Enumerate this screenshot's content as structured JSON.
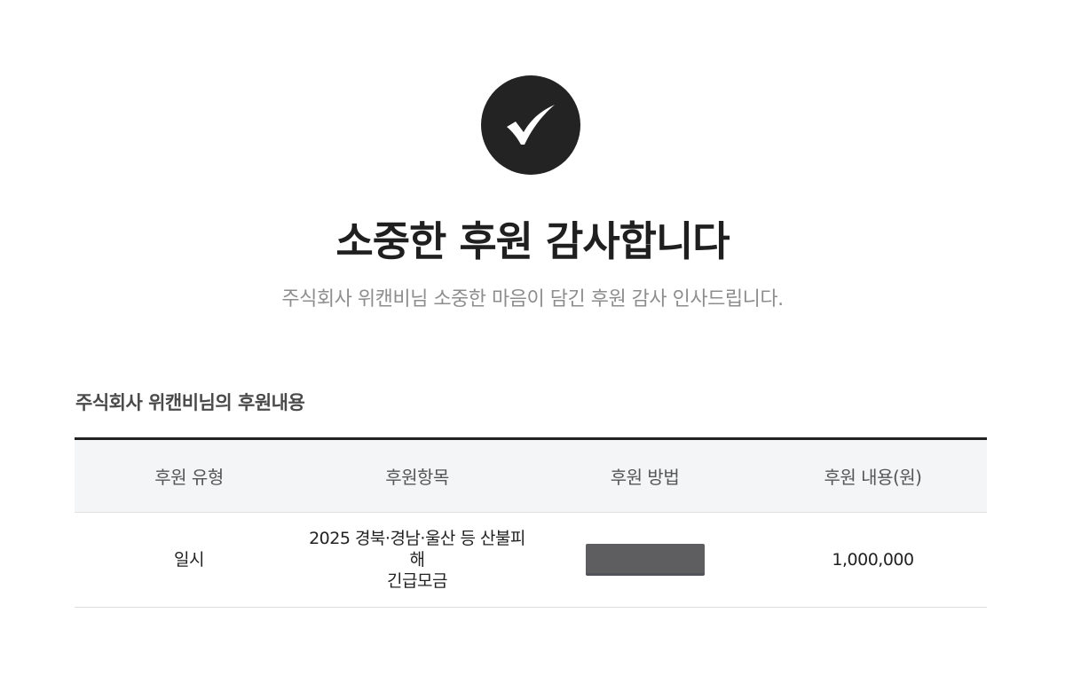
{
  "header": {
    "icon": "check-icon",
    "title": "소중한 후원 감사합니다",
    "subtitle": "주식회사 위캔비님 소중한 마음이 담긴 후원 감사 인사드립니다."
  },
  "section": {
    "title": "주식회사 위캔비님의 후원내용"
  },
  "table": {
    "headers": [
      "후원 유형",
      "후원항목",
      "후원 방법",
      "후원 내용(원)"
    ],
    "rows": [
      {
        "type": "일시",
        "item_line1": "2025 경북·경남·울산 등 산불피해",
        "item_line2": "긴급모금",
        "method": "",
        "amount": "1,000,000"
      }
    ]
  },
  "colors": {
    "icon_circle": "#232323",
    "header_bg": "#f4f5f6",
    "table_top_border": "#222222",
    "subtitle_text": "#8d8d8d",
    "masked_block": "#5e5e60"
  }
}
